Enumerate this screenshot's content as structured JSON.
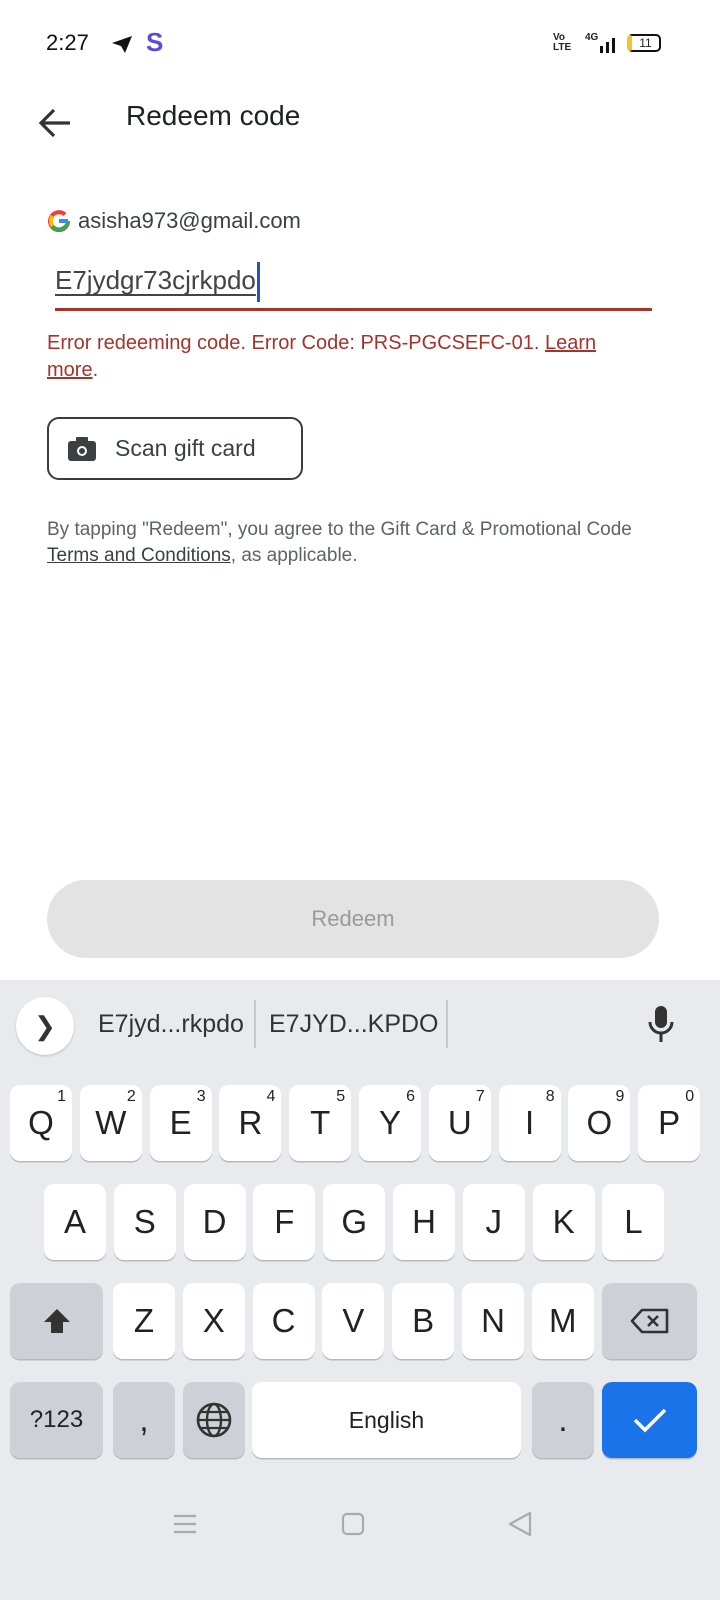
{
  "status": {
    "time": "2:27",
    "battery": "11",
    "network": "4G"
  },
  "header": {
    "title": "Redeem code"
  },
  "account": {
    "email": "asisha973@gmail.com"
  },
  "code_input": {
    "value": "E7jydgr73cjrkpdo"
  },
  "error": {
    "text": "Error redeeming code. Error Code: PRS-PGCSEFC-01. ",
    "link": "Learn more",
    "after": "."
  },
  "scan_button": {
    "label": "Scan gift card"
  },
  "terms": {
    "before": "By tapping \"Redeem\", you agree to the Gift Card & Promotional Code ",
    "link": "Terms and Conditions",
    "after": ", as applicable."
  },
  "redeem_button": {
    "label": "Redeem"
  },
  "keyboard": {
    "suggestions": [
      "E7jyd...rkpdo",
      "E7JYD...KPDO"
    ],
    "row1": [
      [
        "Q",
        "1"
      ],
      [
        "W",
        "2"
      ],
      [
        "E",
        "3"
      ],
      [
        "R",
        "4"
      ],
      [
        "T",
        "5"
      ],
      [
        "Y",
        "6"
      ],
      [
        "U",
        "7"
      ],
      [
        "I",
        "8"
      ],
      [
        "O",
        "9"
      ],
      [
        "P",
        "0"
      ]
    ],
    "row2": [
      "A",
      "S",
      "D",
      "F",
      "G",
      "H",
      "J",
      "K",
      "L"
    ],
    "row3": [
      "Z",
      "X",
      "C",
      "V",
      "B",
      "N",
      "M"
    ],
    "symbols_label": "?123",
    "comma": ",",
    "space_label": "English",
    "period": "."
  }
}
